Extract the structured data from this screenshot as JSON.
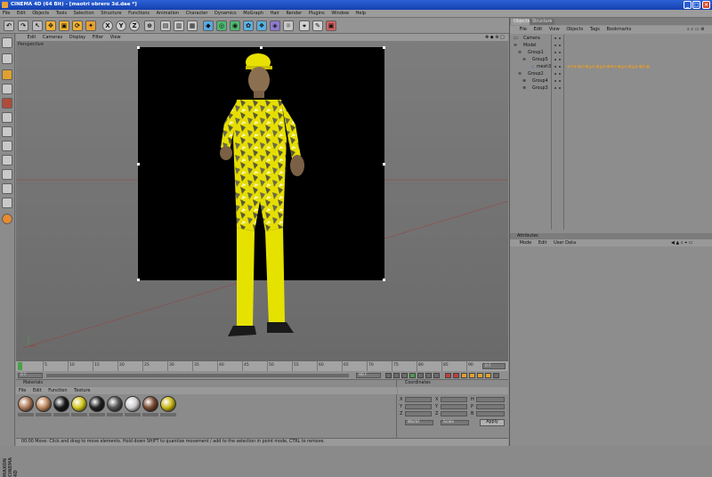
{
  "window": {
    "title": "CINEMA 4D (64 Bit) - [maotri obrero 3d.dae *]",
    "min": "_",
    "max": "□",
    "close": "×"
  },
  "menubar": [
    "File",
    "Edit",
    "Objects",
    "Tools",
    "Selection",
    "Structure",
    "Functions",
    "Animation",
    "Character",
    "Dynamics",
    "MoGraph",
    "Hair",
    "Render",
    "Plugins",
    "Window",
    "Help"
  ],
  "toolbar_letters": {
    "x": "X",
    "y": "Y",
    "z": "Z"
  },
  "viewport": {
    "menu": [
      "Edit",
      "Cameras",
      "Display",
      "Filter",
      "View"
    ],
    "label": "Perspective"
  },
  "timeline": {
    "ticks": [
      "0",
      "5",
      "10",
      "15",
      "20",
      "25",
      "30",
      "35",
      "40",
      "45",
      "50",
      "55",
      "60",
      "65",
      "70",
      "75",
      "80",
      "85",
      "90"
    ],
    "end_field": "0 F",
    "start_field": "0 F",
    "max_field": "90 F"
  },
  "materials": {
    "title": "Materials",
    "menu": [
      "File",
      "Edit",
      "Function",
      "Texture"
    ],
    "swatches": [
      {
        "color": "#b07b5a"
      },
      {
        "color": "#c08a60"
      },
      {
        "color": "#1a1a1a"
      },
      {
        "color": "#d4c820"
      },
      {
        "color": "#222222"
      },
      {
        "color": "#555555"
      },
      {
        "color": "#cfcfcf"
      },
      {
        "color": "#7a4a30"
      },
      {
        "color": "#c9b818"
      }
    ]
  },
  "coordinates": {
    "title": "Coordinates",
    "rows": [
      "X",
      "Y",
      "Z"
    ],
    "mid": [
      "X",
      "Y",
      "Z"
    ],
    "right": [
      "H",
      "P",
      "B"
    ],
    "dropdown1": "World",
    "dropdown2": "Scale",
    "apply": "Apply"
  },
  "status": "00:00  Move: Click and drag to move elements. Hold down SHIFT to quantize movement / add to the selection in point mode, CTRL to remove.",
  "objects": {
    "tabs": [
      "Objects",
      "Structure"
    ],
    "menu": [
      "File",
      "Edit",
      "View",
      "Objects",
      "Tags",
      "Bookmarks"
    ],
    "tree": [
      {
        "name": "Camera",
        "indent": 0
      },
      {
        "name": "Model",
        "indent": 0
      },
      {
        "name": "Group1",
        "indent": 1
      },
      {
        "name": "Group5",
        "indent": 2
      },
      {
        "name": "mesh3",
        "indent": 3
      },
      {
        "name": "Group2",
        "indent": 1
      },
      {
        "name": "Group4",
        "indent": 2
      },
      {
        "name": "Group3",
        "indent": 2
      }
    ]
  },
  "attributes": {
    "title": "Attributes",
    "menu": [
      "Mode",
      "Edit",
      "User Data"
    ]
  },
  "brand": "MAXON CINEMA 4D",
  "colors": {
    "accent_yellow": "#e8e000",
    "title_blue": "#1e4fc8"
  }
}
